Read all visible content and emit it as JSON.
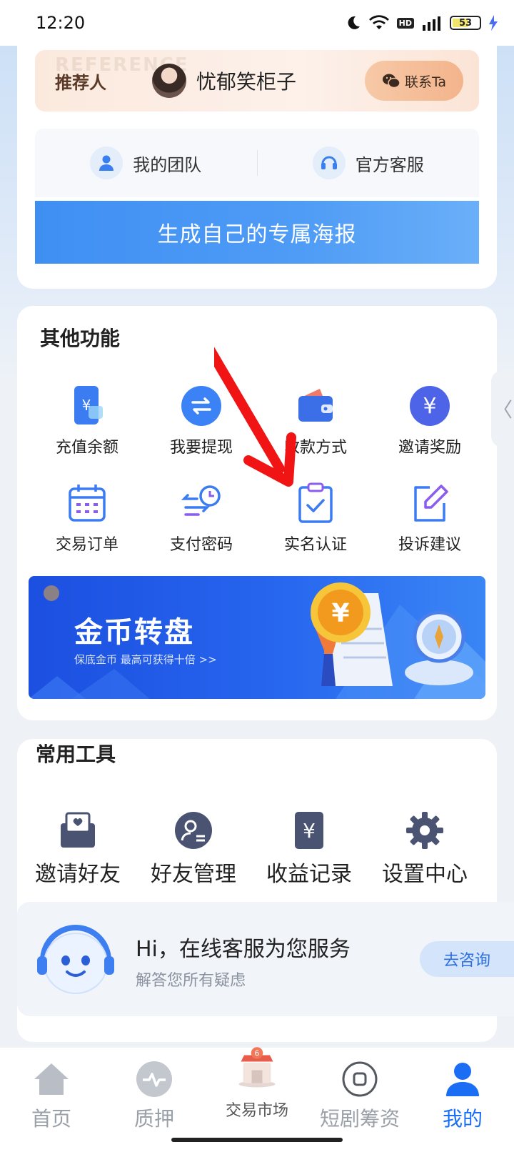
{
  "status_bar": {
    "time": "12:20",
    "battery": "53"
  },
  "referrer": {
    "watermark": "REFERENCE",
    "label": "推荐人",
    "name": "忧郁笑柜子",
    "contact_label": "联系Ta"
  },
  "quick_links": [
    {
      "label": "我的团队",
      "icon": "user-icon"
    },
    {
      "label": "官方客服",
      "icon": "headset-icon"
    }
  ],
  "poster_button": "生成自己的专属海报",
  "other_functions": {
    "title": "其他功能",
    "items": [
      {
        "label": "充值余额",
        "icon": "phone-yen-icon"
      },
      {
        "label": "我要提现",
        "icon": "exchange-icon"
      },
      {
        "label": "收款方式",
        "icon": "wallet-icon"
      },
      {
        "label": "邀请奖励",
        "icon": "yen-coin-icon"
      },
      {
        "label": "交易订单",
        "icon": "calendar-icon"
      },
      {
        "label": "支付密码",
        "icon": "clock-arrows-icon"
      },
      {
        "label": "实名认证",
        "icon": "clipboard-check-icon"
      },
      {
        "label": "投诉建议",
        "icon": "edit-icon"
      }
    ],
    "banner": {
      "title": "金币转盘",
      "subtitle": "保底金币 最高可获得十倍 >>",
      "coin_symbol": "¥"
    }
  },
  "common_tools": {
    "title": "常用工具",
    "items": [
      {
        "label": "邀请好友",
        "icon": "heart-envelope-icon"
      },
      {
        "label": "好友管理",
        "icon": "user-manage-icon"
      },
      {
        "label": "收益记录",
        "icon": "yen-document-icon"
      },
      {
        "label": "设置中心",
        "icon": "gear-icon"
      }
    ]
  },
  "service": {
    "title": "Hi，在线客服为您服务",
    "subtitle": "解答您所有疑虑",
    "button": "去咨询"
  },
  "side_handle": "〈",
  "bottom_nav": [
    {
      "label": "首页",
      "icon": "home-icon"
    },
    {
      "label": "质押",
      "icon": "pulse-icon"
    },
    {
      "label": "交易市场",
      "icon": "shop-icon"
    },
    {
      "label": "短剧筹资",
      "icon": "square-button-icon"
    },
    {
      "label": "我的",
      "icon": "profile-icon"
    }
  ],
  "colors": {
    "accent": "#1b6ef3",
    "annotation_arrow": "#f01414"
  }
}
